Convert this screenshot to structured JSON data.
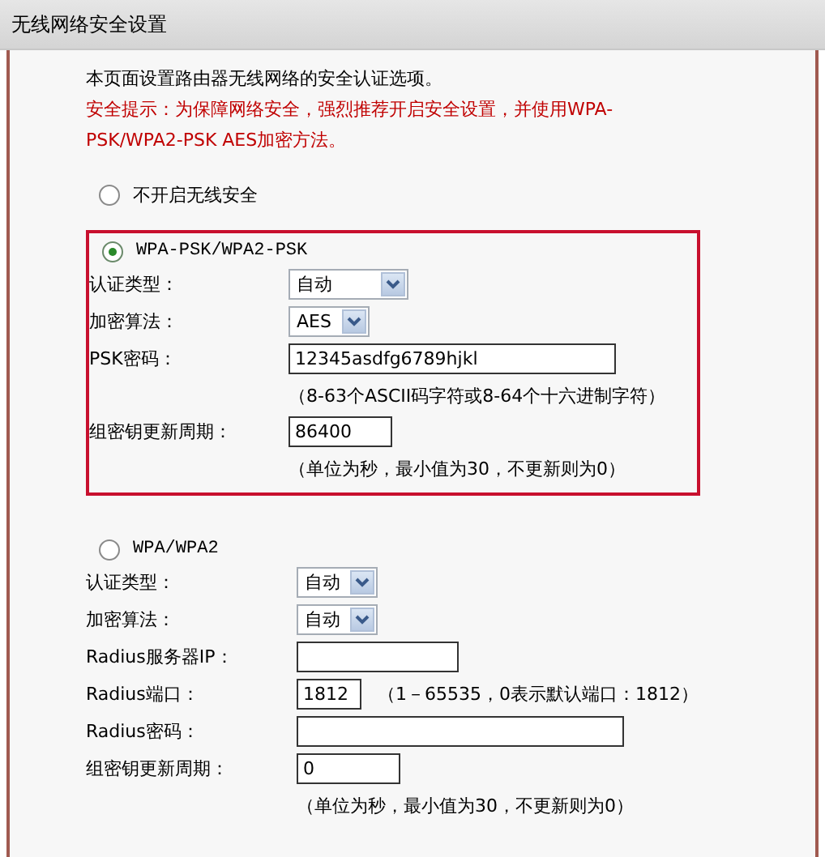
{
  "header": {
    "title": "无线网络安全设置"
  },
  "intro": "本页面设置路由器无线网络的安全认证选项。",
  "warning": "安全提示：为保障网络安全，强烈推荐开启安全设置，并使用WPA-PSK/WPA2-PSK AES加密方法。",
  "modes": [
    {
      "label": "不开启无线安全",
      "selected": false,
      "highlighted": false
    },
    {
      "label": "WPA-PSK/WPA2-PSK",
      "selected": true,
      "highlighted": true,
      "fields": [
        {
          "label": "认证类型：",
          "kind": "select",
          "value": "自动"
        },
        {
          "label": "加密算法：",
          "kind": "select",
          "value": "AES"
        },
        {
          "label": "PSK密码：",
          "kind": "text",
          "value": "12345asdfg6789hjkl",
          "hint": "（8-63个ASCII码字符或8-64个十六进制字符）"
        },
        {
          "label": "组密钥更新周期：",
          "kind": "text",
          "value": "86400",
          "hint": "（单位为秒，最小值为30，不更新则为0）"
        }
      ]
    },
    {
      "label": "WPA/WPA2",
      "selected": false,
      "highlighted": false,
      "fields": [
        {
          "label": "认证类型：",
          "kind": "select",
          "value": "自动"
        },
        {
          "label": "加密算法：",
          "kind": "select",
          "value": "自动"
        },
        {
          "label": "Radius服务器IP：",
          "kind": "text"
        },
        {
          "label": "Radius端口：",
          "kind": "text",
          "value": "1812",
          "inline_hint": "（1－65535，0表示默认端口：1812）"
        },
        {
          "label": "Radius密码：",
          "kind": "text"
        },
        {
          "label": "组密钥更新周期：",
          "kind": "text",
          "value": "0",
          "hint": "（单位为秒，最小值为30，不更新则为0）"
        }
      ]
    }
  ]
}
